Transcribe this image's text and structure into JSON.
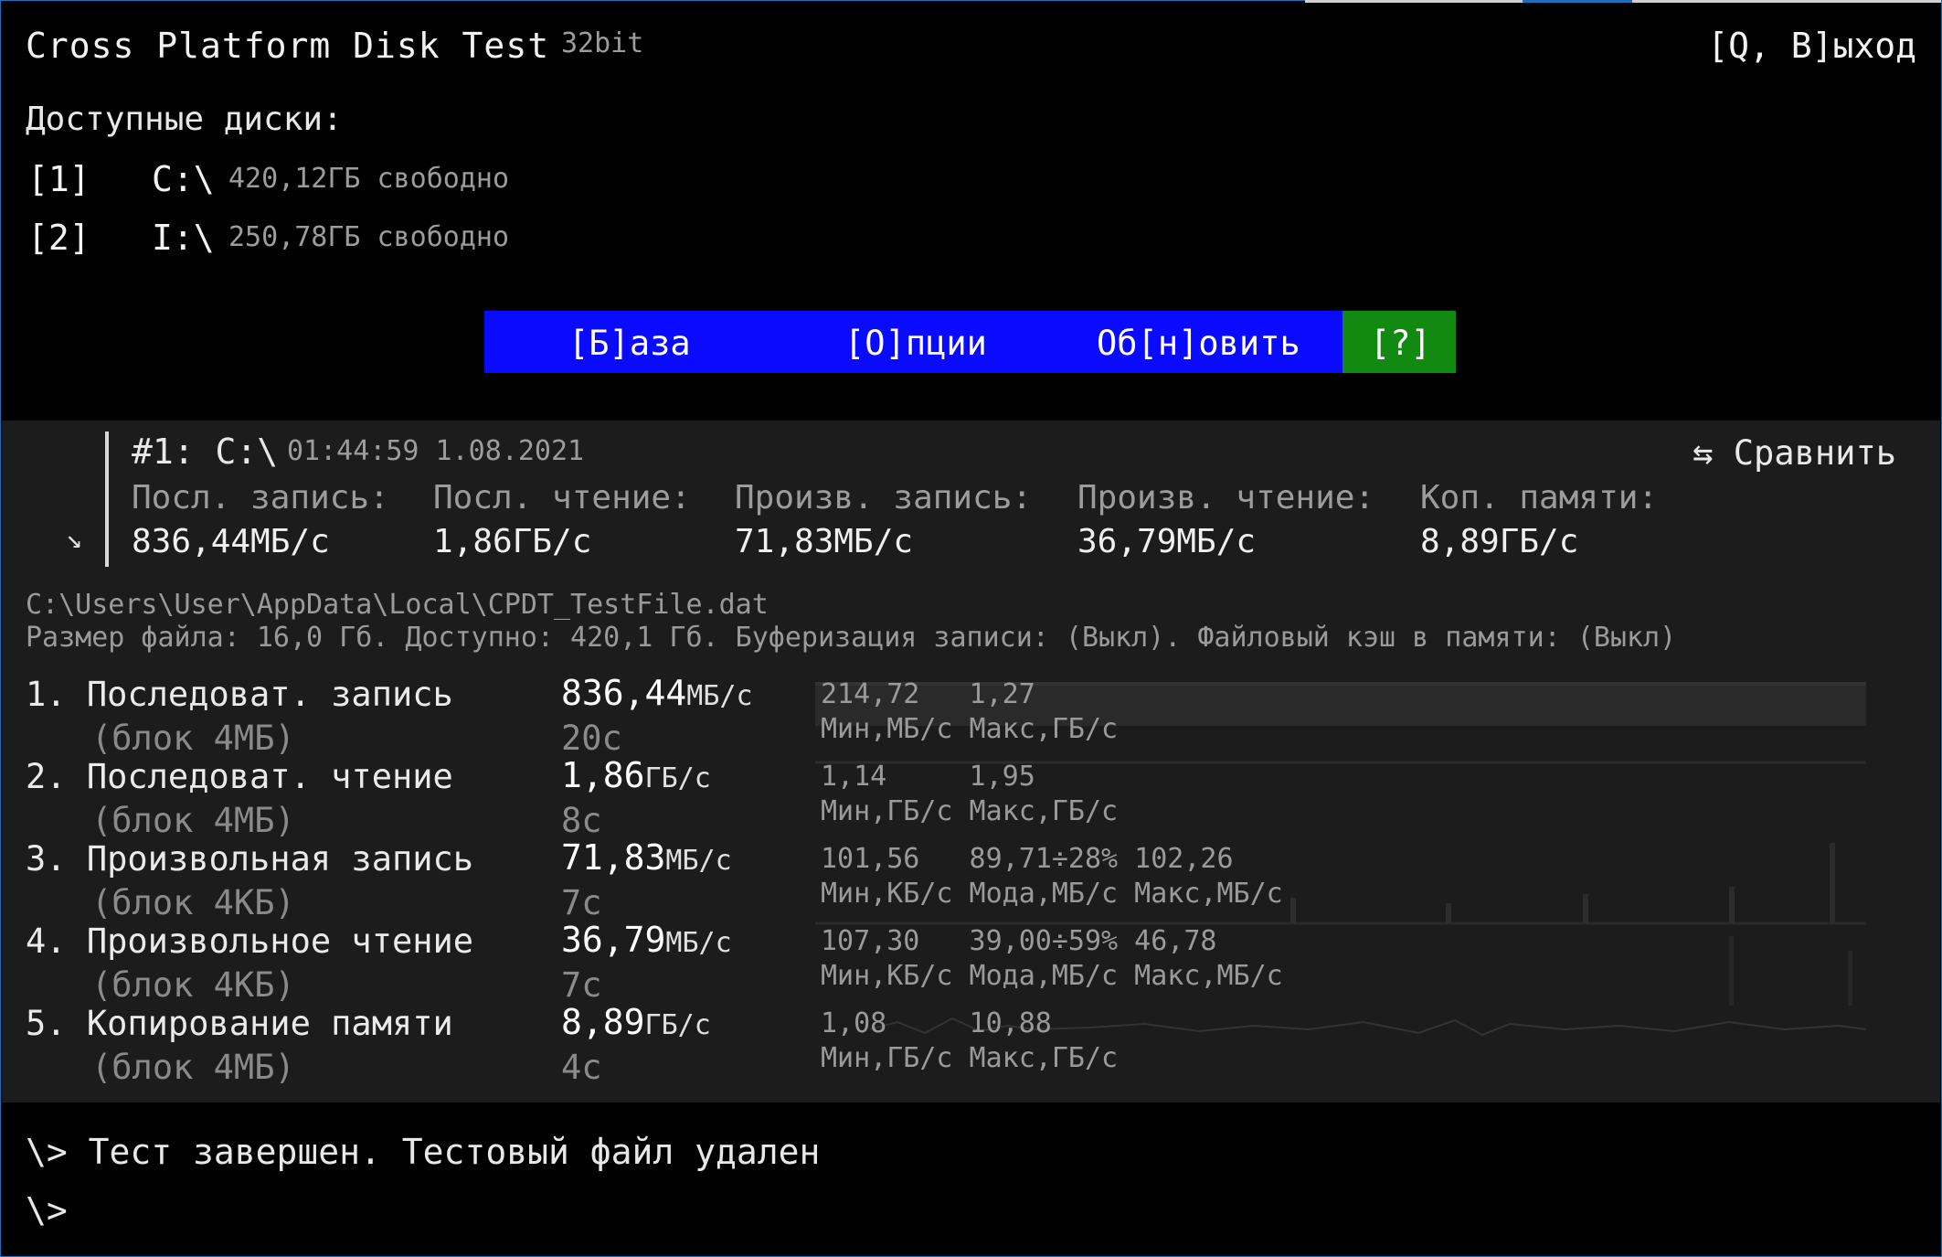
{
  "header": {
    "title": "Cross Platform Disk Test",
    "bits": "32bit",
    "exit_label": "[Q, В]ыход"
  },
  "drives": {
    "heading": "Доступные диски:",
    "items": [
      {
        "key": "[1]",
        "letter": "C:\\",
        "free": "420,12ГБ свободно"
      },
      {
        "key": "[2]",
        "letter": "I:\\",
        "free": "250,78ГБ свободно"
      }
    ]
  },
  "menu": {
    "base": "[Б]аза",
    "options": "[О]пции",
    "refresh": "Об[н]овить",
    "help": "[?]"
  },
  "summary": {
    "arrow": "↘",
    "drive": "#1: C:\\",
    "time": "01:44:59 1.08.2021",
    "compare": "⇆ Сравнить",
    "columns": [
      {
        "label": "Посл. запись:",
        "value": "836,44МБ/с"
      },
      {
        "label": "Посл. чтение:",
        "value": "1,86ГБ/с"
      },
      {
        "label": "Произв. запись:",
        "value": "71,83МБ/с"
      },
      {
        "label": "Произв. чтение:",
        "value": "36,79МБ/с"
      },
      {
        "label": "Коп. памяти:",
        "value": "8,89ГБ/с"
      }
    ]
  },
  "file": {
    "path": "C:\\Users\\User\\AppData\\Local\\CPDT_TestFile.dat",
    "info": "Размер файла: 16,0 Гб. Доступно: 420,1 Гб. Буферизация записи: (Выкл). Файловый кэш в памяти: (Выкл)"
  },
  "tests": [
    {
      "title": "1. Последоват. запись",
      "block": "(блок 4МБ)",
      "value": "836,44",
      "unit": "МБ/с",
      "duration": "20с",
      "stats_top": "214,72   1,27",
      "stats_bottom": "Мин,МБ/с Макс,ГБ/с"
    },
    {
      "title": "2. Последоват. чтение",
      "block": "(блок 4МБ)",
      "value": "1,86",
      "unit": "ГБ/с",
      "duration": "8с",
      "stats_top": "1,14     1,95",
      "stats_bottom": "Мин,ГБ/с Макс,ГБ/с"
    },
    {
      "title": "3. Произвольная запись",
      "block": "(блок 4КБ)",
      "value": "71,83",
      "unit": "МБ/с",
      "duration": "7с",
      "stats_top": "101,56   89,71÷28% 102,26",
      "stats_bottom": "Мин,КБ/с Мода,МБ/с Макс,МБ/с"
    },
    {
      "title": "4. Произвольное чтение",
      "block": "(блок 4КБ)",
      "value": "36,79",
      "unit": "МБ/с",
      "duration": "7с",
      "stats_top": "107,30   39,00÷59% 46,78",
      "stats_bottom": "Мин,КБ/с Мода,МБ/с Макс,МБ/с"
    },
    {
      "title": "5. Копирование памяти",
      "block": "(блок 4МБ)",
      "value": "8,89",
      "unit": "ГБ/с",
      "duration": "4с",
      "stats_top": "1,08     10,88",
      "stats_bottom": "Мин,ГБ/с Макс,ГБ/с"
    }
  ],
  "log": {
    "line1": "\\> Тест завершен. Тестовый файл удален",
    "line2": "\\>"
  },
  "colors": {
    "menu_bg": "#0a0aff",
    "help_bg": "#128a12",
    "panel_bg": "#1c1c1c"
  }
}
